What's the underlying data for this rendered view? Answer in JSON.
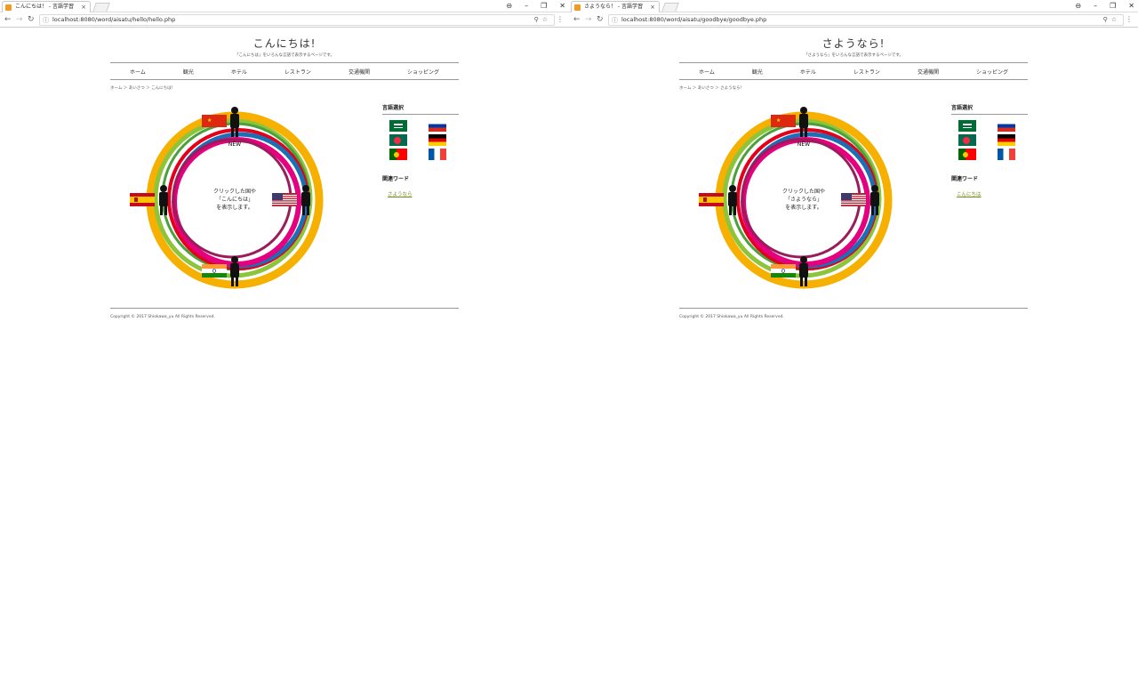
{
  "windows": [
    {
      "tab_title": "こんにちは！ - 言語学習",
      "url": "localhost:8080/word/aisatu/hello/hello.php",
      "page": {
        "title": "こんにちは!",
        "subtitle": "「こんにちは」をいろんな言語で表示するページです。",
        "nav": [
          "ホーム",
          "観光",
          "ホテル",
          "レストラン",
          "交通機関",
          "ショッピング"
        ],
        "breadcrumb": "ホーム ＞ あいさつ ＞ こんにちは！",
        "center_text": [
          "クリックした国や",
          "「こんにちは」",
          "を表示します。"
        ],
        "new_label": "NEW",
        "sidebar_title": "言語選択",
        "related_title": "関連ワード",
        "related_link": "さようなら",
        "footer": "Copyright © 2017 Shiokawa_yu All Rights Reserved."
      }
    },
    {
      "tab_title": "さようなら！ - 言語学習",
      "url": "localhost:8080/word/aisatu/goodbye/goodbye.php",
      "page": {
        "title": "さようなら!",
        "subtitle": "「さようなら」をいろんな言語で表示するページです。",
        "nav": [
          "ホーム",
          "観光",
          "ホテル",
          "レストラン",
          "交通機関",
          "ショッピング"
        ],
        "breadcrumb": "ホーム ＞ あいさつ ＞ さようなら！",
        "center_text": [
          "クリックした国や",
          "「さようなら」",
          "を表示します。"
        ],
        "new_label": "NEW",
        "sidebar_title": "言語選択",
        "related_title": "関連ワード",
        "related_link": "こんにちは",
        "footer": "Copyright © 2017 Shiokawa_yu All Rights Reserved."
      }
    }
  ],
  "browser": {
    "window_controls": [
      "person-icon",
      "minimize-icon",
      "restore-icon",
      "close-icon"
    ]
  },
  "colors": {
    "ring": [
      "#f5b000",
      "#8cc43c",
      "#e2001a",
      "#1b6fb5",
      "#e4007f",
      "#9a1d5a"
    ],
    "link": "#6a8a1a"
  },
  "flags": [
    "saudi-arabia",
    "russia",
    "bangladesh",
    "germany",
    "portugal",
    "france"
  ]
}
